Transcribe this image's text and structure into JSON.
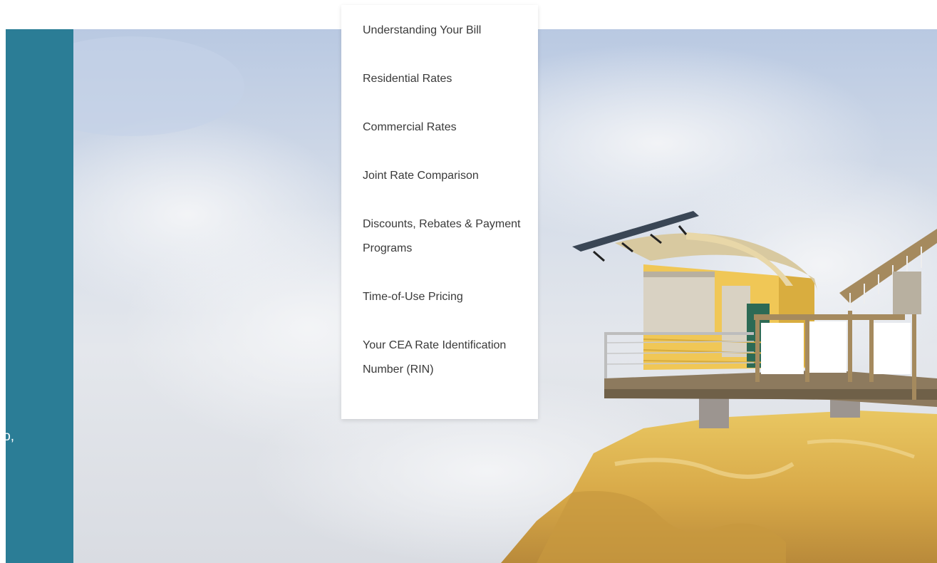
{
  "side_panel": {
    "partial_text": "lo,",
    "color": "#2b7d96"
  },
  "menu": {
    "items": [
      {
        "label": "Understanding Your Bill"
      },
      {
        "label": "Residential Rates"
      },
      {
        "label": "Commercial Rates"
      },
      {
        "label": "Joint Rate Comparison"
      },
      {
        "label": "Discounts, Rebates & Payment Programs"
      },
      {
        "label": "Time-of-Use Pricing"
      },
      {
        "label": "Your CEA Rate Identification Number (RIN)"
      }
    ]
  }
}
